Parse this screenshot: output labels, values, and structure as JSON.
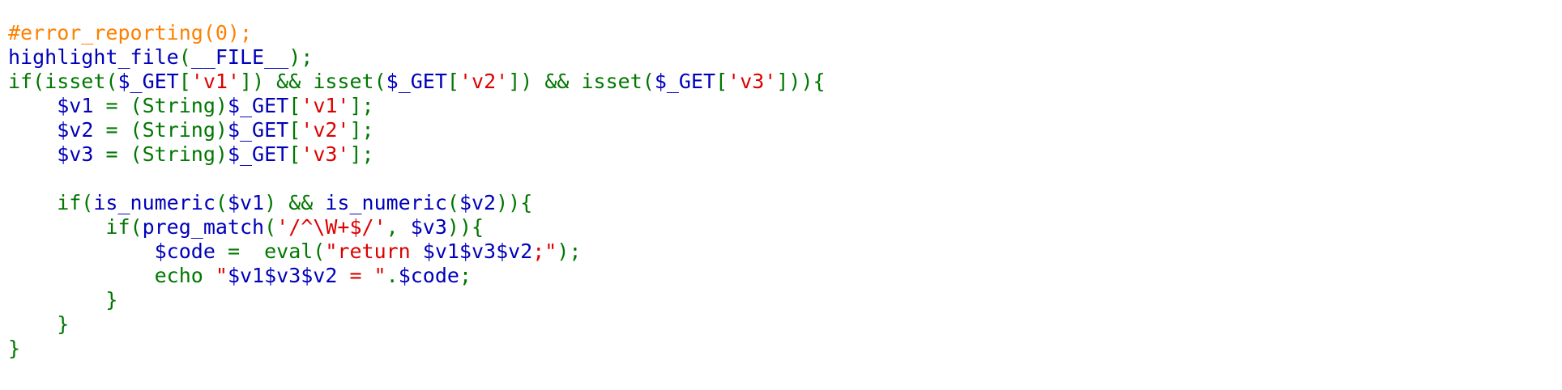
{
  "colors": {
    "comment": "#ff8000",
    "keyword": "#007700",
    "default": "#0000bb",
    "string": "#dd0000",
    "background": "#ffffff"
  },
  "code": {
    "lines": [
      [
        [
          "comment",
          "#error_reporting(0);"
        ]
      ],
      [
        [
          "default",
          "highlight_file"
        ],
        [
          "keyword",
          "("
        ],
        [
          "default",
          "__FILE__"
        ],
        [
          "keyword",
          ");"
        ]
      ],
      [
        [
          "keyword",
          "if(isset("
        ],
        [
          "default",
          "$_GET"
        ],
        [
          "keyword",
          "["
        ],
        [
          "string",
          "'v1'"
        ],
        [
          "keyword",
          "]) && isset("
        ],
        [
          "default",
          "$_GET"
        ],
        [
          "keyword",
          "["
        ],
        [
          "string",
          "'v2'"
        ],
        [
          "keyword",
          "]) && isset("
        ],
        [
          "default",
          "$_GET"
        ],
        [
          "keyword",
          "["
        ],
        [
          "string",
          "'v3'"
        ],
        [
          "keyword",
          "])){"
        ]
      ],
      [
        [
          "keyword",
          "    "
        ],
        [
          "default",
          "$v1 "
        ],
        [
          "keyword",
          "= (String)"
        ],
        [
          "default",
          "$_GET"
        ],
        [
          "keyword",
          "["
        ],
        [
          "string",
          "'v1'"
        ],
        [
          "keyword",
          "];"
        ]
      ],
      [
        [
          "keyword",
          "    "
        ],
        [
          "default",
          "$v2 "
        ],
        [
          "keyword",
          "= (String)"
        ],
        [
          "default",
          "$_GET"
        ],
        [
          "keyword",
          "["
        ],
        [
          "string",
          "'v2'"
        ],
        [
          "keyword",
          "];"
        ]
      ],
      [
        [
          "keyword",
          "    "
        ],
        [
          "default",
          "$v3 "
        ],
        [
          "keyword",
          "= (String)"
        ],
        [
          "default",
          "$_GET"
        ],
        [
          "keyword",
          "["
        ],
        [
          "string",
          "'v3'"
        ],
        [
          "keyword",
          "];"
        ]
      ],
      [],
      [
        [
          "keyword",
          "    if("
        ],
        [
          "default",
          "is_numeric"
        ],
        [
          "keyword",
          "("
        ],
        [
          "default",
          "$v1"
        ],
        [
          "keyword",
          ") && "
        ],
        [
          "default",
          "is_numeric"
        ],
        [
          "keyword",
          "("
        ],
        [
          "default",
          "$v2"
        ],
        [
          "keyword",
          ")){"
        ]
      ],
      [
        [
          "keyword",
          "        if("
        ],
        [
          "default",
          "preg_match"
        ],
        [
          "keyword",
          "("
        ],
        [
          "string",
          "'/^\\W+$/'"
        ],
        [
          "keyword",
          ", "
        ],
        [
          "default",
          "$v3"
        ],
        [
          "keyword",
          ")){"
        ]
      ],
      [
        [
          "keyword",
          "            "
        ],
        [
          "default",
          "$code "
        ],
        [
          "keyword",
          "=  eval("
        ],
        [
          "string",
          "\"return "
        ],
        [
          "default",
          "$v1$v3$v2"
        ],
        [
          "string",
          ";\""
        ],
        [
          "keyword",
          ");"
        ]
      ],
      [
        [
          "keyword",
          "            echo "
        ],
        [
          "string",
          "\""
        ],
        [
          "default",
          "$v1$v3$v2"
        ],
        [
          "string",
          " = \""
        ],
        [
          "keyword",
          "."
        ],
        [
          "default",
          "$code"
        ],
        [
          "keyword",
          ";"
        ]
      ],
      [
        [
          "keyword",
          "        }"
        ]
      ],
      [
        [
          "keyword",
          "    }"
        ]
      ],
      [
        [
          "keyword",
          "}"
        ]
      ]
    ]
  }
}
